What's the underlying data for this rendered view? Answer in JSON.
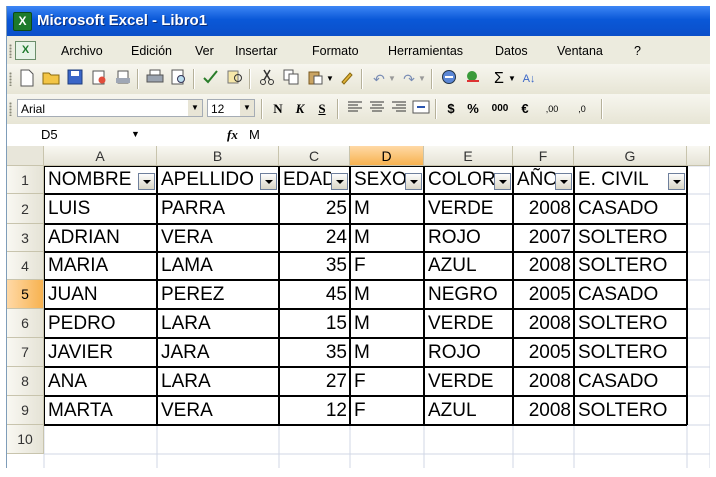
{
  "window": {
    "title": "Microsoft Excel - Libro1",
    "app_icon": "excel-icon"
  },
  "menu": [
    "Archivo",
    "Edición",
    "Ver",
    "Insertar",
    "Formato",
    "Herramientas",
    "Datos",
    "Ventana",
    "?"
  ],
  "toolbar": {
    "icons": [
      "new-icon",
      "open-icon",
      "save-icon",
      "permission-icon",
      "print-icon",
      "print-preview-icon",
      "spelling-icon",
      "research-icon",
      "cut-icon",
      "copy-icon",
      "paste-icon",
      "format-painter-icon",
      "undo-icon",
      "redo-icon",
      "hyperlink-icon",
      "autosum-icon"
    ],
    "autosum": "Σ"
  },
  "format_toolbar": {
    "font": "Arial",
    "size": "12",
    "bold": "N",
    "italic": "K",
    "underline": "S",
    "currency": "$",
    "percent": "%",
    "thousands": "000",
    "euro": "€",
    "inc_decimal": ",00",
    "dec_decimal": ",0"
  },
  "formula_bar": {
    "name_box": "D5",
    "fx": "fx",
    "value": "M"
  },
  "sheet": {
    "columns": [
      "A",
      "B",
      "C",
      "D",
      "E",
      "F",
      "G"
    ],
    "rows": [
      "1",
      "2",
      "3",
      "4",
      "5",
      "6",
      "7",
      "8",
      "9",
      "10"
    ],
    "active_cell": "D5",
    "headers": [
      "NOMBRE",
      "APELLIDO",
      "EDAD",
      "SEXO",
      "COLOR",
      "AÑO",
      "E. CIVIL"
    ],
    "data": [
      [
        "LUIS",
        "PARRA",
        "25",
        "M",
        "VERDE",
        "2008",
        "CASADO"
      ],
      [
        "ADRIAN",
        "VERA",
        "24",
        "M",
        "ROJO",
        "2007",
        "SOLTERO"
      ],
      [
        "MARIA",
        "LAMA",
        "35",
        "F",
        "AZUL",
        "2008",
        "SOLTERO"
      ],
      [
        "JUAN",
        "PEREZ",
        "45",
        "M",
        "NEGRO",
        "2005",
        "CASADO"
      ],
      [
        "PEDRO",
        "LARA",
        "15",
        "M",
        "VERDE",
        "2008",
        "SOLTERO"
      ],
      [
        "JAVIER",
        "JARA",
        "35",
        "M",
        "ROJO",
        "2005",
        "SOLTERO"
      ],
      [
        "ANA",
        "LARA",
        "27",
        "F",
        "VERDE",
        "2008",
        "CASADO"
      ],
      [
        "MARTA",
        "VERA",
        "12",
        "F",
        "AZUL",
        "2008",
        "SOLTERO"
      ]
    ]
  },
  "colors": {
    "titlebar": "#0a58d8",
    "active_header": "#f7b250",
    "toolbar_bg": "#ecebde"
  }
}
